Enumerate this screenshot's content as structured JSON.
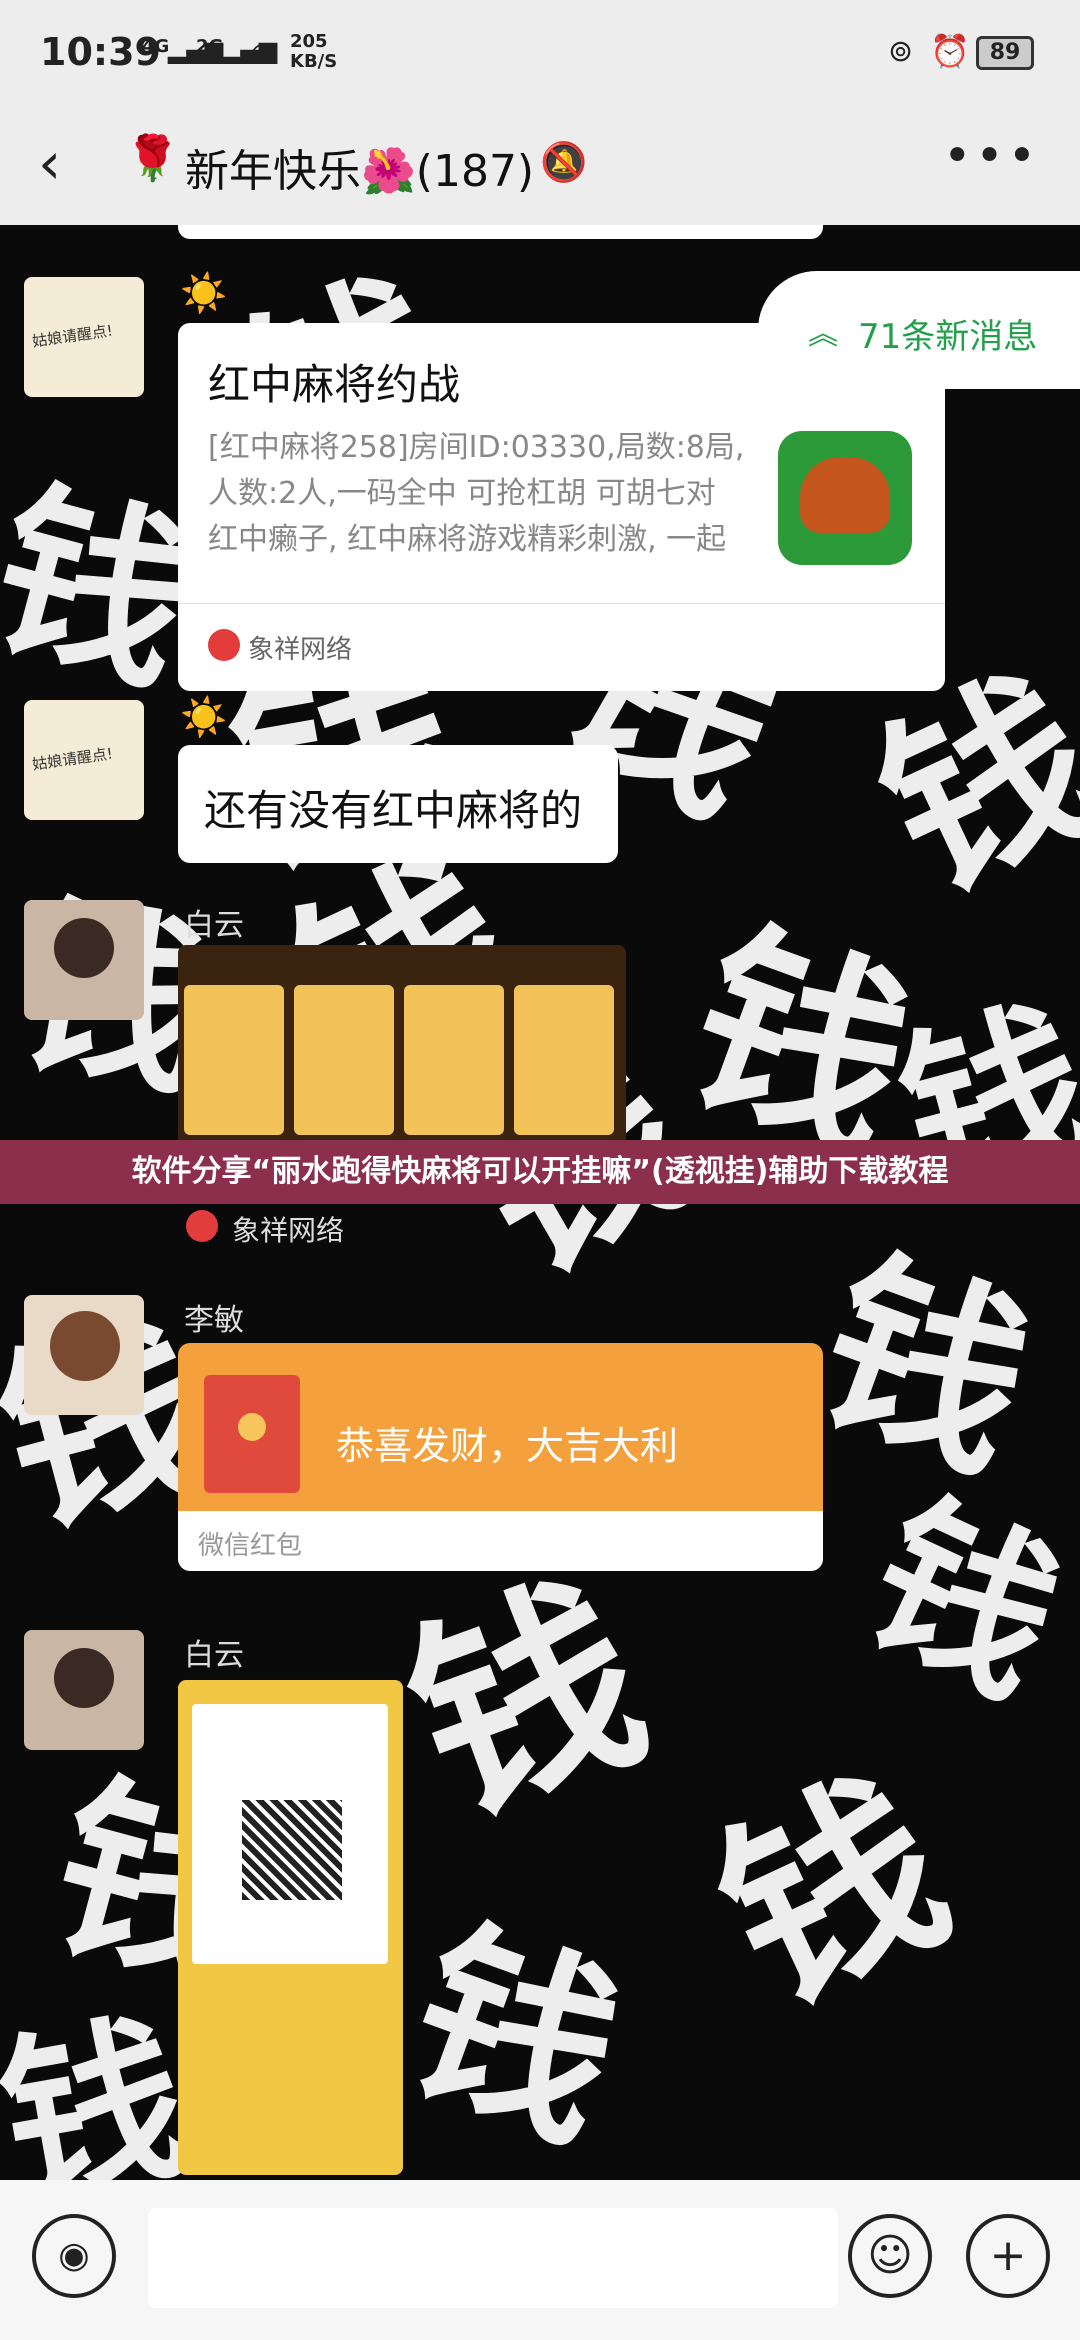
{
  "status_bar": {
    "time": "10:39",
    "network_1": "4G",
    "network_2": "2G",
    "speed_value": "205",
    "speed_unit": "KB/S",
    "battery": "89"
  },
  "header": {
    "title": "新年快乐🌺(187)",
    "rose_emoji": "🌹",
    "mute_icon": "mute-icon",
    "more_icon": "more-icon"
  },
  "new_messages": {
    "label": "71条新消息"
  },
  "messages": [
    {
      "type": "card",
      "sender_emoji": "☀️",
      "title": "红中麻将约战",
      "description": "[红中麻将258]房间ID:03330,局数:8局,人数:2人,一码全中 可抢杠胡 可胡七对 红中癞子, 红中麻将游戏精彩刺激, 一起来玩...",
      "source": "象祥网络"
    },
    {
      "type": "text",
      "sender_emoji": "☀️",
      "text": "还有没有红中麻将的"
    },
    {
      "type": "image",
      "sender": "白云",
      "source": "象祥网络"
    },
    {
      "type": "red_packet",
      "sender": "李敏",
      "text": "恭喜发财，大吉大利",
      "footer": "微信红包"
    },
    {
      "type": "image",
      "sender": "白云"
    }
  ],
  "avatar_text": "姑娘请醒点!",
  "watermark_char": "钱",
  "banner": {
    "text": "软件分享“丽水跑得快麻将可以开挂嘛”(透视挂)辅助下载教程"
  },
  "input_bar": {
    "voice_icon": "voice-icon",
    "emoji_icon": "emoji-icon",
    "plus_icon": "plus-icon"
  },
  "colors": {
    "bg": "#0a0a0a",
    "bar": "#ededed",
    "red_packet": "#f4a03c",
    "accent_green": "#23a04a",
    "banner": "#8b2f4d"
  }
}
